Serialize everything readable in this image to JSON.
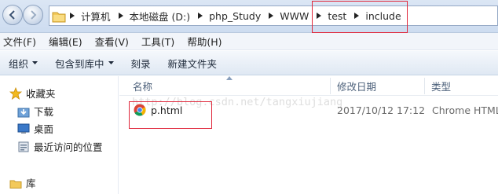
{
  "address_bar": {
    "breadcrumbs": [
      "计算机",
      "本地磁盘 (D:)",
      "php_Study",
      "WWW",
      "test",
      "include"
    ]
  },
  "menu_bar": {
    "items": [
      "文件(F)",
      "编辑(E)",
      "查看(V)",
      "工具(T)",
      "帮助(H)"
    ]
  },
  "toolbar": {
    "organize": "组织",
    "include_in_library": "包含到库中",
    "burn": "刻录",
    "new_folder": "新建文件夹"
  },
  "nav_pane": {
    "favorites": "收藏夹",
    "items": [
      "下载",
      "桌面",
      "最近访问的位置"
    ],
    "libraries": "库"
  },
  "file_list": {
    "columns": {
      "name": "名称",
      "date_modified": "修改日期",
      "type": "类型"
    },
    "rows": [
      {
        "name": "p.html",
        "date_modified": "2017/10/12 17:12",
        "type": "Chrome HTML"
      }
    ]
  },
  "watermark": "http://blog.csdn.net/tangxiujiang",
  "colors": {
    "highlight_box": "#e0263a",
    "toolbar_bg": "#dfe8f3",
    "header_text": "#4c607a"
  }
}
